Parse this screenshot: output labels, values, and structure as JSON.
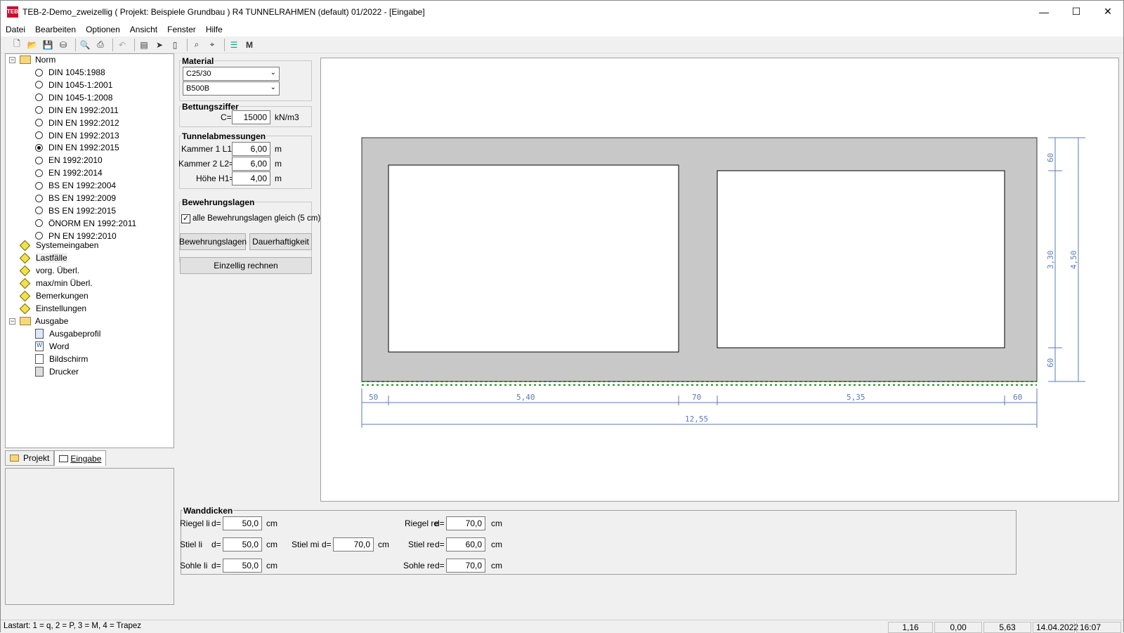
{
  "window": {
    "title": "TEB-2-Demo_zweizellig ( Projekt: Beispiele Grundbau ) R4 TUNNELRAHMEN (default) 01/2022  - [Eingabe]",
    "app_icon": "TEB"
  },
  "menu": [
    "Datei",
    "Bearbeiten",
    "Optionen",
    "Ansicht",
    "Fenster",
    "Hilfe"
  ],
  "tree": {
    "norm_label": "Norm",
    "norms": [
      {
        "label": "DIN 1045:1988",
        "selected": false
      },
      {
        "label": "DIN 1045-1:2001",
        "selected": false
      },
      {
        "label": "DIN 1045-1:2008",
        "selected": false
      },
      {
        "label": "DIN EN 1992:2011",
        "selected": false
      },
      {
        "label": "DIN EN 1992:2012",
        "selected": false
      },
      {
        "label": "DIN EN 1992:2013",
        "selected": false
      },
      {
        "label": "DIN EN 1992:2015",
        "selected": true
      },
      {
        "label": "EN 1992:2010",
        "selected": false
      },
      {
        "label": "EN 1992:2014",
        "selected": false
      },
      {
        "label": "BS EN 1992:2004",
        "selected": false
      },
      {
        "label": "BS EN 1992:2009",
        "selected": false
      },
      {
        "label": "BS EN 1992:2015",
        "selected": false
      },
      {
        "label": "ÖNORM EN 1992:2011",
        "selected": false
      },
      {
        "label": "PN EN 1992:2010",
        "selected": false
      }
    ],
    "sections": [
      "Systemeingaben",
      "Lastfälle",
      "vorg. Überl.",
      "max/min Überl.",
      "Bemerkungen",
      "Einstellungen"
    ],
    "output_label": "Ausgabe",
    "outputs": [
      "Ausgabeprofil",
      "Word",
      "Bildschirm",
      "Drucker"
    ]
  },
  "tabs": [
    "Projekt",
    "Eingabe"
  ],
  "material": {
    "title": "Material",
    "concrete": "C25/30",
    "steel": "B500B"
  },
  "bettung": {
    "title": "Bettungsziffer",
    "label": "C=",
    "value": "15000",
    "unit": "kN/m3"
  },
  "tunnel": {
    "title": "Tunnelabmessungen",
    "rows": [
      {
        "label": "Kammer 1  L1=",
        "value": "6,00",
        "unit": "m"
      },
      {
        "label": "Kammer 2  L2=",
        "value": "6,00",
        "unit": "m"
      },
      {
        "label": "Höhe H1=",
        "value": "4,00",
        "unit": "m"
      }
    ]
  },
  "bewehrung": {
    "title": "Bewehrungslagen",
    "checkbox_label": "alle Bewehrungslagen gleich (5 cm)",
    "checked": true,
    "btn_lagen": "Bewehrungslagen",
    "btn_dauer": "Dauerhaftigkeit"
  },
  "einzellig_btn": "Einzellig rechnen",
  "drawing": {
    "dims_bottom": [
      "50",
      "5,40",
      "70",
      "5,35",
      "60"
    ],
    "dim_total": "12,55",
    "dims_right_inner": [
      "60",
      "3,30",
      "60"
    ],
    "dim_right_outer": "4,50"
  },
  "wanddicken": {
    "title": "Wanddicken",
    "riegel_li": {
      "label": "Riegel li",
      "d": "d=",
      "value": "50,0",
      "unit": "cm"
    },
    "riegel_re": {
      "label": "Riegel re",
      "d": "d=",
      "value": "70,0",
      "unit": "cm"
    },
    "stiel_li": {
      "label": "Stiel li",
      "d": "d=",
      "value": "50,0",
      "unit": "cm"
    },
    "stiel_mi": {
      "label": "Stiel mi",
      "d": "d=",
      "value": "70,0",
      "unit": "cm"
    },
    "stiel_re": {
      "label": "Stiel re",
      "d": "d=",
      "value": "60,0",
      "unit": "cm"
    },
    "sohle_li": {
      "label": "Sohle li",
      "d": "d=",
      "value": "50,0",
      "unit": "cm"
    },
    "sohle_re": {
      "label": "Sohle re",
      "d": "d=",
      "value": "70,0",
      "unit": "cm"
    }
  },
  "status": {
    "hint": "Lastart:  1 = q, 2 = P, 3 = M, 4 = Trapez",
    "v1": "1,16",
    "v2": "0,00",
    "v3": "5,63",
    "date": "14.04.2022",
    "time": "16:07"
  }
}
